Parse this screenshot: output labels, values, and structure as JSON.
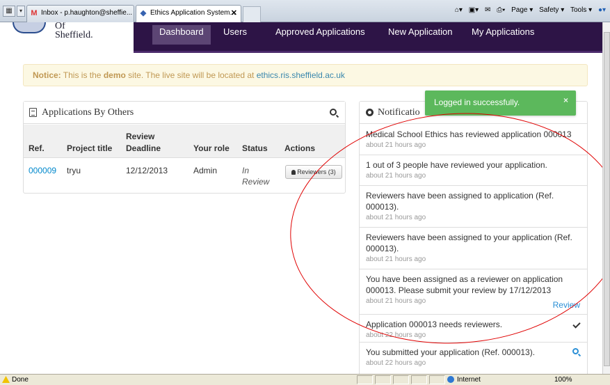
{
  "browser": {
    "tabs": [
      {
        "label": "Inbox - p.haughton@sheffie...",
        "active": false
      },
      {
        "label": "Ethics Application System...",
        "active": true
      }
    ],
    "command_bar": [
      "Page ▾",
      "Safety ▾",
      "Tools ▾"
    ]
  },
  "site": {
    "brand": {
      "line1": "Of",
      "line2": "Sheffield."
    },
    "nav": [
      "Dashboard",
      "Users",
      "Approved Applications",
      "New Application",
      "My Applications"
    ]
  },
  "notice": {
    "label": "Notice:",
    "text1": " This is the ",
    "demo": "demo",
    "text2": " site. The live site will be located at ",
    "link": "ethics.ris.sheffield.ac.uk"
  },
  "applications_by_others": {
    "title": "Applications By Others",
    "columns": {
      "ref": "Ref.",
      "project": "Project title",
      "review1": "Review",
      "review2": "Deadline",
      "role": "Your role",
      "status": "Status",
      "actions": "Actions"
    },
    "row": {
      "ref": "000009",
      "project": "tryu",
      "deadline": "12/12/2013",
      "role": "Admin",
      "status1": "In",
      "status2": "Review",
      "button": "Reviewers (3)"
    }
  },
  "notifications": {
    "title": "Notificatio",
    "items": [
      {
        "text": "Medical School Ethics has reviewed application 000013",
        "time": "about 21 hours ago",
        "action": ""
      },
      {
        "text": "1 out of 3 people have reviewed your application.",
        "time": "about 21 hours ago",
        "action": ""
      },
      {
        "text": "Reviewers have been assigned to application (Ref. 000013).",
        "time": "about 21 hours ago",
        "action": ""
      },
      {
        "text": "Reviewers have been assigned to your application (Ref. 000013).",
        "time": "about 21 hours ago",
        "action": ""
      },
      {
        "text": "You have been assigned as a reviewer on application 000013. Please submit your review by 17/12/2013",
        "time": "about 21 hours ago",
        "action": "Review"
      },
      {
        "text": "Application 000013 needs reviewers.",
        "time": "about 22 hours ago",
        "action": "check-icon"
      },
      {
        "text": "You submitted your application (Ref. 000013).",
        "time": "about 22 hours ago",
        "action": "search-icon"
      }
    ]
  },
  "toast": {
    "text": "Logged in successfully.",
    "close": "×"
  },
  "statusbar": {
    "left": "Done",
    "zone": "Internet",
    "zoom": "100%"
  }
}
